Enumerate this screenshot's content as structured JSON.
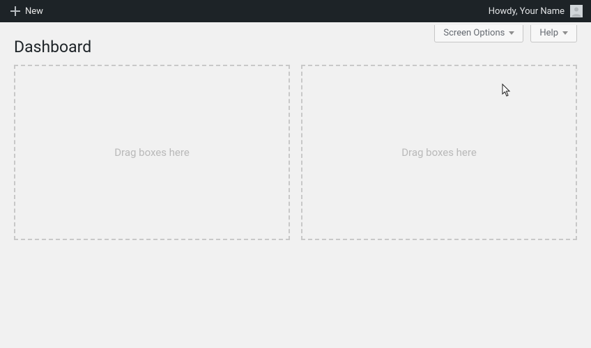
{
  "admin_bar": {
    "new_label": "New",
    "howdy_text": "Howdy, Your Name"
  },
  "top_buttons": {
    "screen_options": "Screen Options",
    "help": "Help"
  },
  "page": {
    "title": "Dashboard"
  },
  "drop_zones": {
    "left_placeholder": "Drag boxes here",
    "right_placeholder": "Drag boxes here"
  }
}
